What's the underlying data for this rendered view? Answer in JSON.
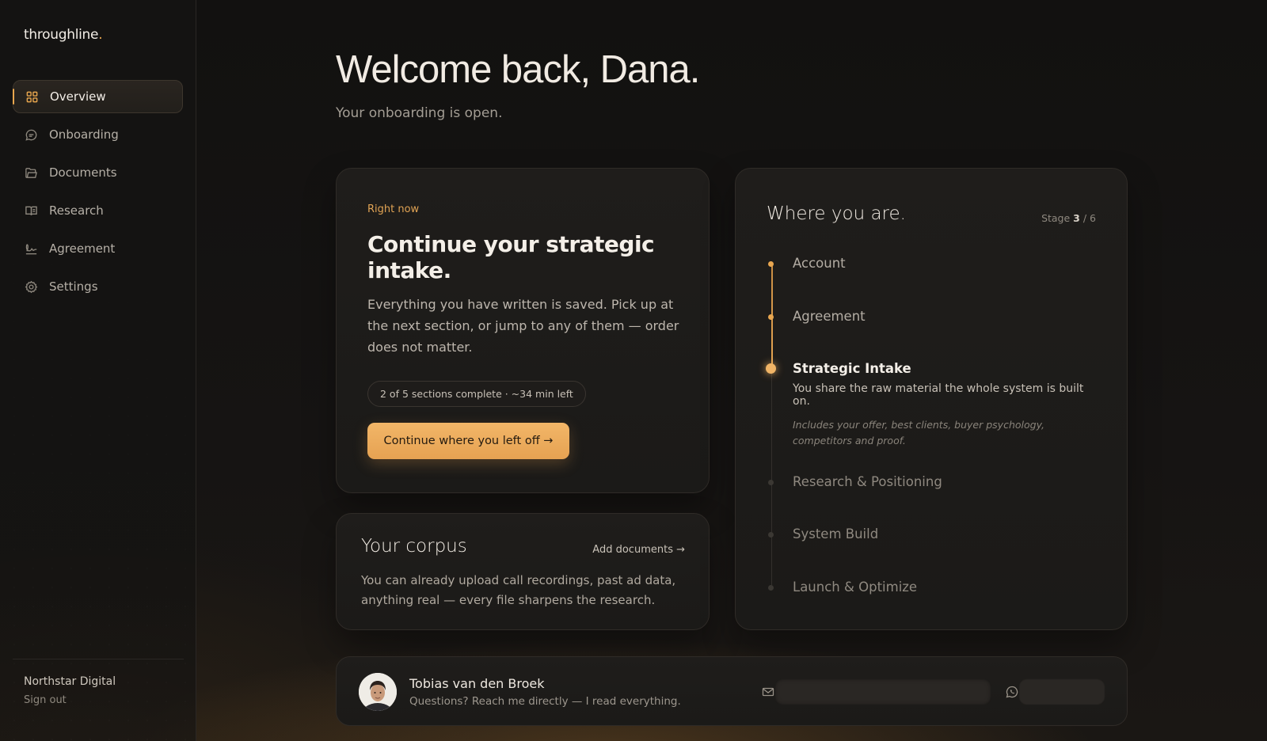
{
  "brand": {
    "name": "throughline",
    "dot": "."
  },
  "sidebar": {
    "items": [
      {
        "label": "Overview",
        "icon": "grid-icon",
        "active": true
      },
      {
        "label": "Onboarding",
        "icon": "chat-bubble-icon"
      },
      {
        "label": "Documents",
        "icon": "folder-icon"
      },
      {
        "label": "Research",
        "icon": "book-icon"
      },
      {
        "label": "Agreement",
        "icon": "signature-icon"
      },
      {
        "label": "Settings",
        "icon": "gear-icon"
      }
    ],
    "org": "Northstar Digital",
    "signout": "Sign out"
  },
  "header": {
    "welcome": "Welcome back, Dana.",
    "subtitle": "Your onboarding is open."
  },
  "now_card": {
    "eyebrow": "Right now",
    "title": "Continue your strategic intake.",
    "body": "Everything you have written is saved. Pick up at the next section, or jump to any of them — order does not matter.",
    "progress": "2 of 5 sections complete · ~34 min left",
    "cta": "Continue where you left off  →"
  },
  "corpus_card": {
    "title": "Your corpus",
    "link": "Add documents →",
    "body": "You can already upload call recordings, past ad data, anything real — every file sharpens the research."
  },
  "stages_card": {
    "title": "Where you are.",
    "stage_label": "Stage",
    "current": "3",
    "total": "/ 6",
    "stages": [
      {
        "name": "Account",
        "status": "done"
      },
      {
        "name": "Agreement",
        "status": "done"
      },
      {
        "name": "Strategic Intake",
        "status": "current",
        "desc": "You share the raw material the whole system is built on.",
        "note": "Includes your offer, best clients, buyer psychology, competitors and proof."
      },
      {
        "name": "Research & Positioning",
        "status": "pending"
      },
      {
        "name": "System Build",
        "status": "pending"
      },
      {
        "name": "Launch & Optimize",
        "status": "pending"
      }
    ]
  },
  "contact": {
    "name": "Tobias van den Broek",
    "message": "Questions? Reach me directly — I read everything."
  },
  "colors": {
    "accent": "#e8a64e",
    "background": "#141312",
    "card": "#1d1b19"
  }
}
